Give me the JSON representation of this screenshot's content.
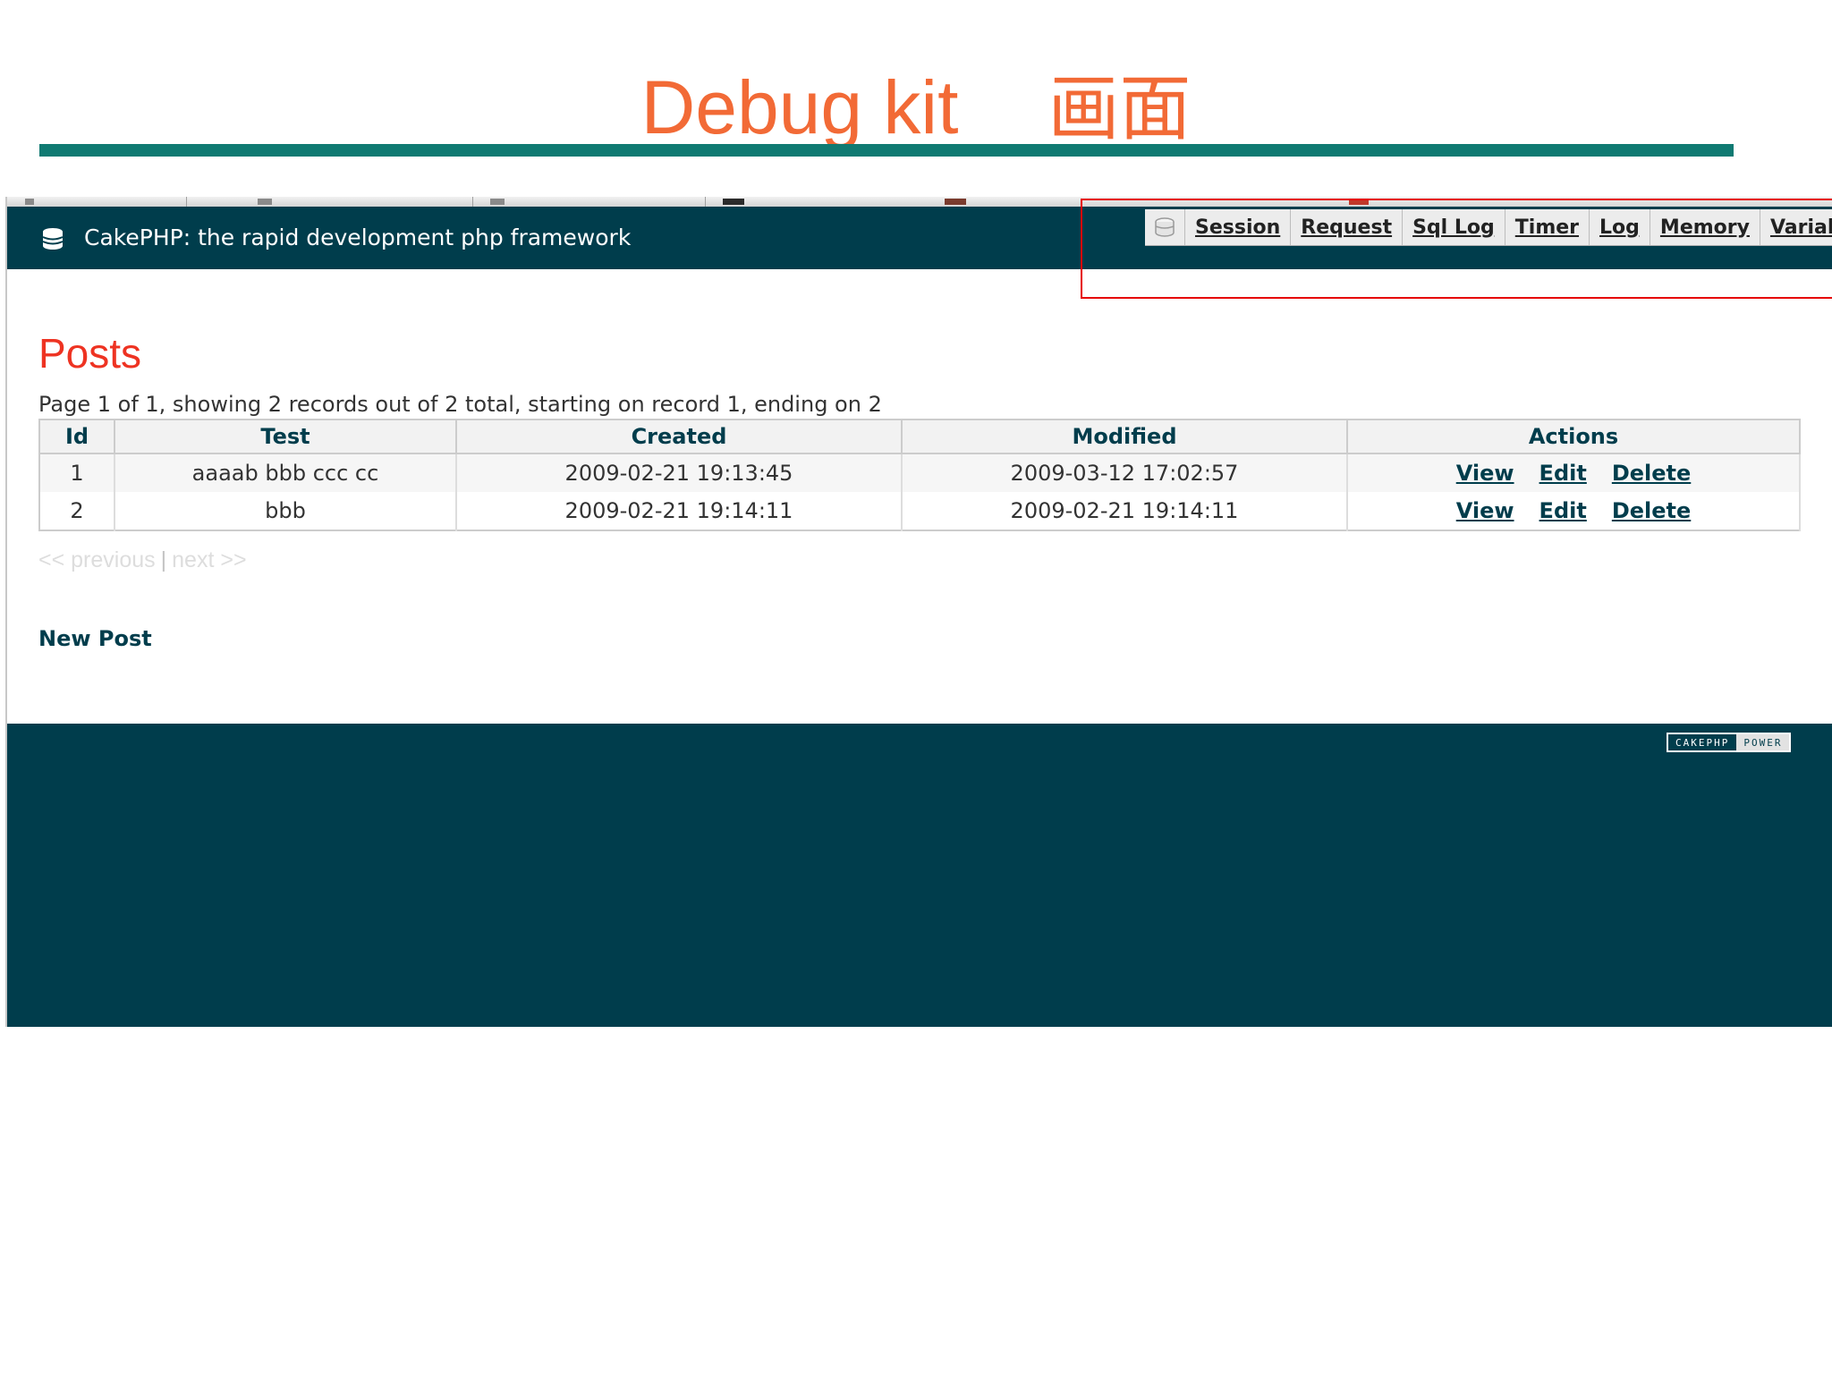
{
  "slide": {
    "title": "Debug kit",
    "title_jp": "画面"
  },
  "app": {
    "site_title": "CakePHP: the rapid development php framework"
  },
  "debug_toolbar": {
    "items": [
      {
        "label": "Session"
      },
      {
        "label": "Request"
      },
      {
        "label": "Sql Log"
      },
      {
        "label": "Timer"
      },
      {
        "label": "Log"
      },
      {
        "label": "Memory"
      },
      {
        "label": "Variables"
      }
    ]
  },
  "page": {
    "heading": "Posts",
    "counter": "Page 1 of 1, showing 2 records out of 2 total, starting on record 1, ending on 2"
  },
  "table": {
    "headers": [
      "Id",
      "Test",
      "Created",
      "Modified",
      "Actions"
    ],
    "rows": [
      {
        "id": "1",
        "test": "aaaab bbb ccc cc",
        "created": "2009-02-21 19:13:45",
        "modified": "2009-03-12 17:02:57"
      },
      {
        "id": "2",
        "test": "bbb",
        "created": "2009-02-21 19:14:11",
        "modified": "2009-02-21 19:14:11"
      }
    ],
    "actions": {
      "view": "View",
      "edit": "Edit",
      "delete": "Delete"
    }
  },
  "paging": {
    "previous": "<< previous",
    "separator": "|",
    "next": "next >>"
  },
  "new_post": "New Post",
  "footer": {
    "badge_left": "CAKEPHP",
    "badge_right": "POWER"
  },
  "colors": {
    "header_bg": "#003d4c",
    "slide_title": "#f26a36",
    "title_rule": "#0f7a72",
    "heading": "#ee3322",
    "highlight": "#e60000"
  }
}
